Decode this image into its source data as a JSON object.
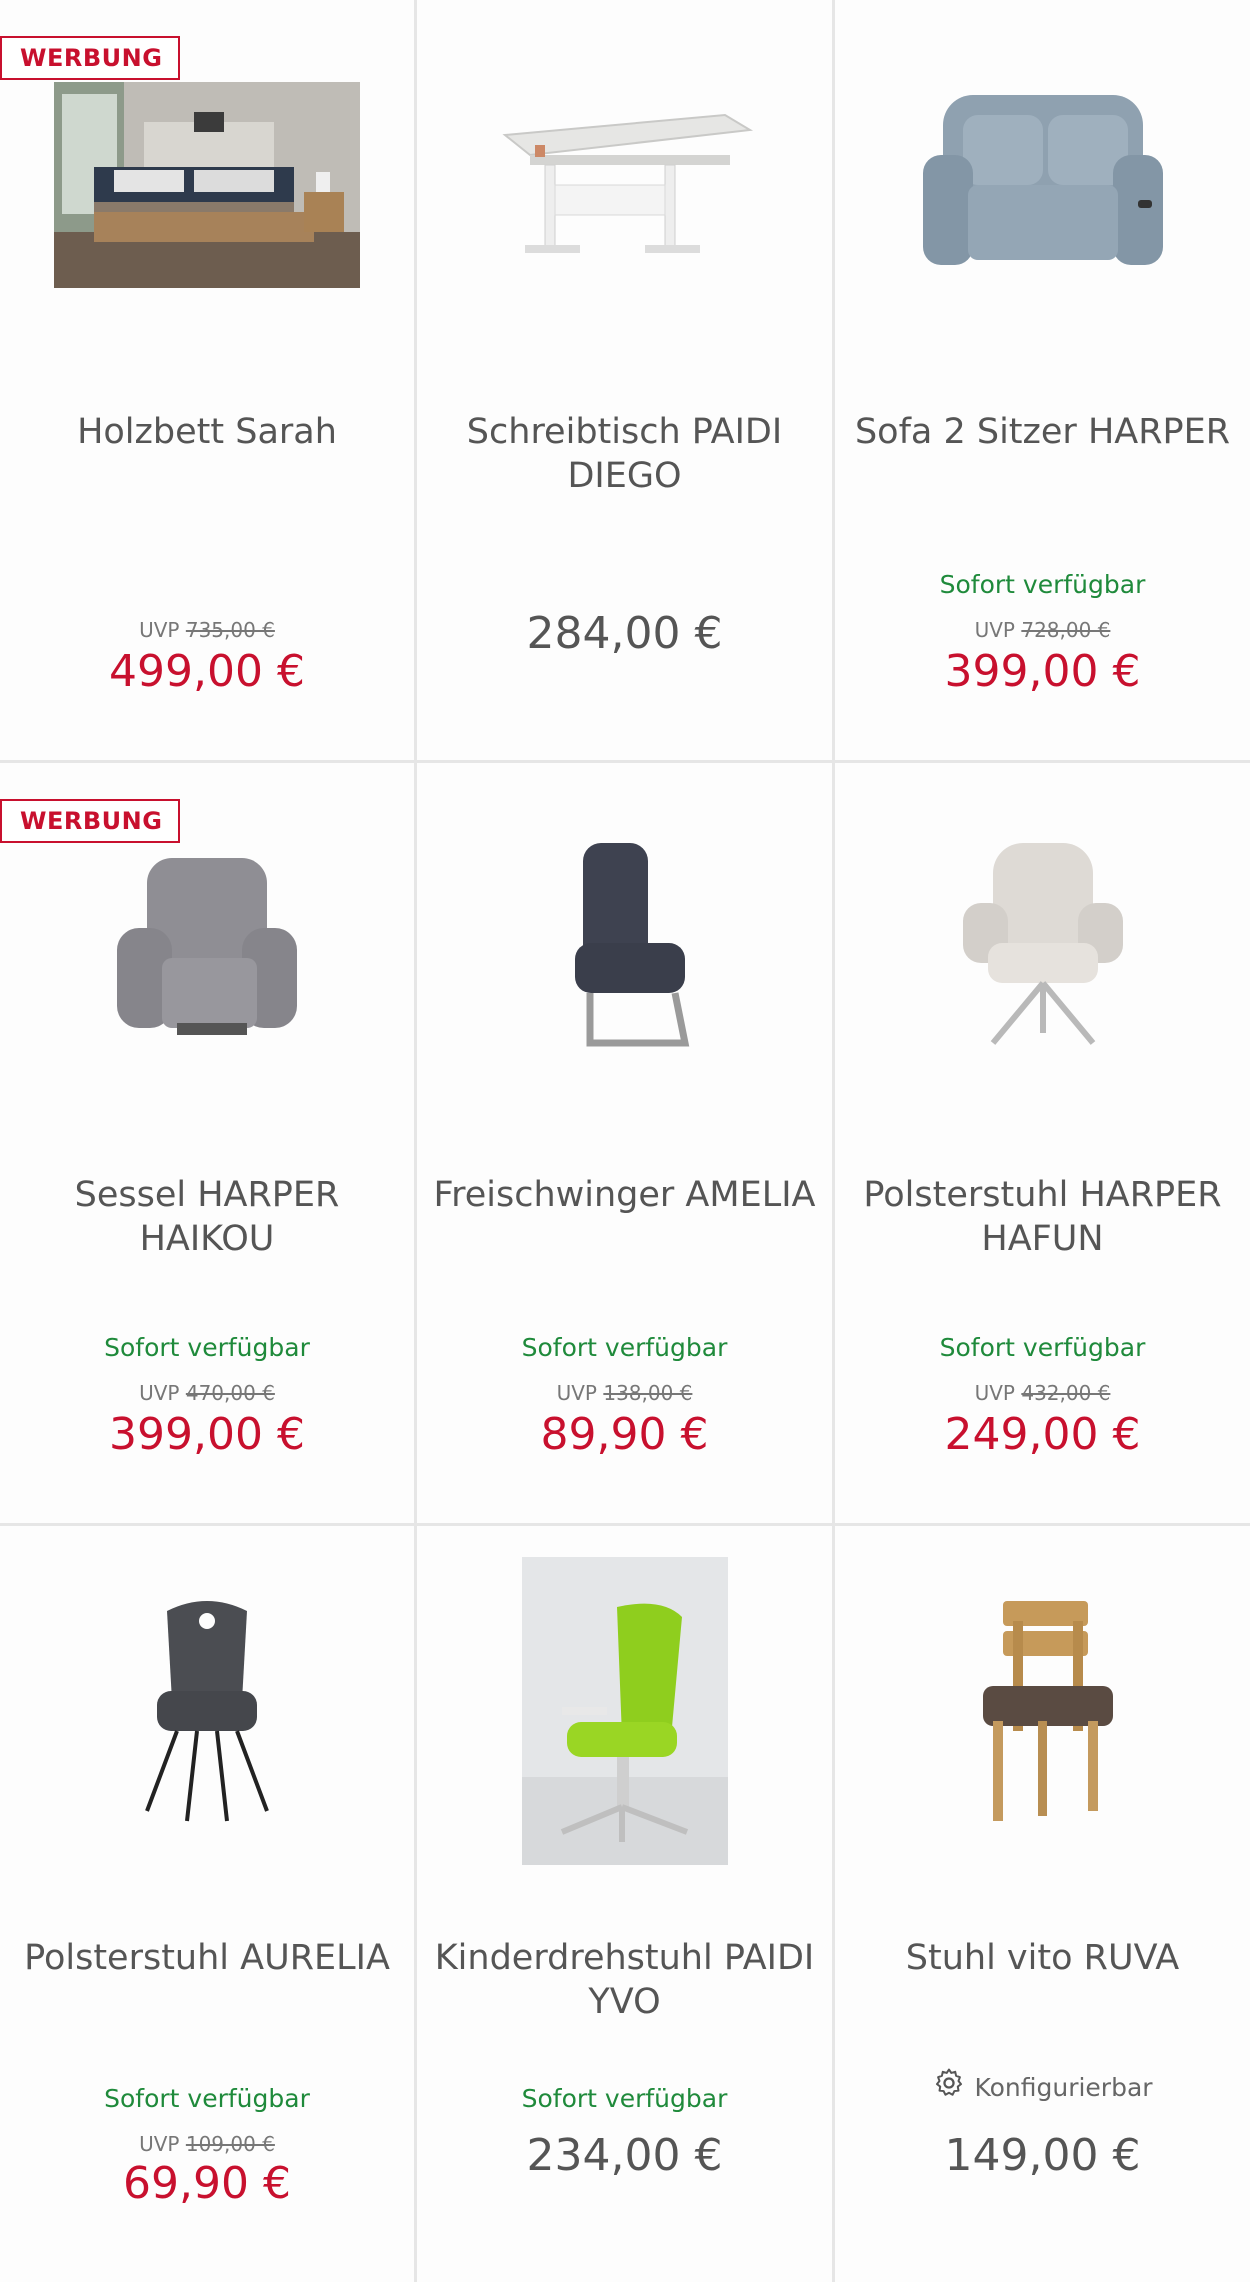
{
  "products": [
    {
      "badge": "WERBUNG",
      "title": "Holzbett Sarah",
      "availability": "",
      "uvp_label": "UVP",
      "uvp": "735,00 €",
      "price": "499,00 €",
      "sale": true,
      "icon": "bed-image"
    },
    {
      "badge": "",
      "title": "Schreibtisch PAIDI DIEGO",
      "availability": "",
      "uvp_label": "",
      "uvp": "",
      "price": "284,00 €",
      "sale": false,
      "icon": "desk-image"
    },
    {
      "badge": "",
      "title": "Sofa 2 Sitzer HARPER",
      "availability": "Sofort verfügbar",
      "uvp_label": "UVP",
      "uvp": "728,00 €",
      "price": "399,00 €",
      "sale": true,
      "icon": "sofa-image"
    },
    {
      "badge": "WERBUNG",
      "title": "Sessel HARPER HAIKOU",
      "availability": "Sofort verfügbar",
      "uvp_label": "UVP",
      "uvp": "470,00 €",
      "price": "399,00 €",
      "sale": true,
      "icon": "armchair-image"
    },
    {
      "badge": "",
      "title": "Freischwinger AMELIA",
      "availability": "Sofort verfügbar",
      "uvp_label": "UVP",
      "uvp": "138,00 €",
      "price": "89,90 €",
      "sale": true,
      "icon": "cantilever-chair-image"
    },
    {
      "badge": "",
      "title": "Polsterstuhl HARPER HAFUN",
      "availability": "Sofort verfügbar",
      "uvp_label": "UVP",
      "uvp": "432,00 €",
      "price": "249,00 €",
      "sale": true,
      "icon": "upholstered-chair-image"
    },
    {
      "badge": "",
      "title": "Polsterstuhl AURELIA",
      "availability": "Sofort verfügbar",
      "uvp_label": "UVP",
      "uvp": "109,00 €",
      "price": "69,90 €",
      "sale": true,
      "icon": "dark-chair-image"
    },
    {
      "badge": "",
      "title": "Kinderdrehstuhl PAIDI YVO",
      "availability": "Sofort verfügbar",
      "uvp_label": "",
      "uvp": "",
      "price": "234,00 €",
      "sale": false,
      "icon": "kids-chair-image"
    },
    {
      "badge": "",
      "title": "Stuhl vito RUVA",
      "availability": "",
      "configurable": "Konfigurierbar",
      "uvp_label": "",
      "uvp": "",
      "price": "149,00 €",
      "sale": false,
      "icon": "wood-chair-image"
    }
  ],
  "colors": {
    "sale": "#c8102e",
    "available": "#1f8a3b",
    "text": "#555555"
  }
}
